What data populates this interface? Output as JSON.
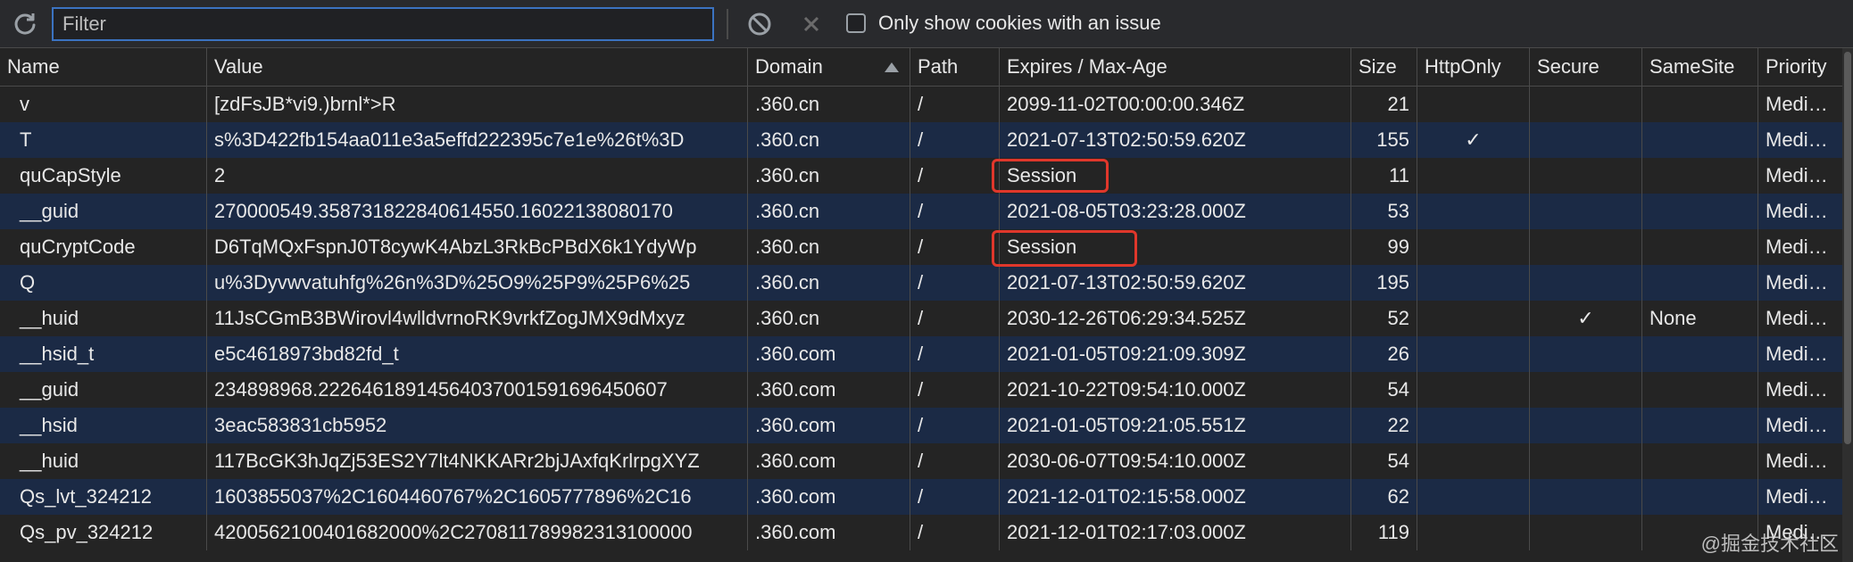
{
  "toolbar": {
    "filter_placeholder": "Filter",
    "only_issue_label": "Only show cookies with an issue"
  },
  "columns": {
    "name": "Name",
    "value": "Value",
    "domain": "Domain",
    "path": "Path",
    "expires": "Expires / Max-Age",
    "size": "Size",
    "httponly": "HttpOnly",
    "secure": "Secure",
    "samesite": "SameSite",
    "priority": "Priority"
  },
  "rows": [
    {
      "name": "v",
      "value": "[zdFsJB*vi9.)brnl*>R",
      "domain": ".360.cn",
      "path": "/",
      "expires": "2099-11-02T00:00:00.346Z",
      "size": "21",
      "httponly": "",
      "secure": "",
      "samesite": "",
      "priority": "Medium"
    },
    {
      "name": "T",
      "value": "s%3D422fb154aa011e3a5effd222395c7e1e%26t%3D",
      "domain": ".360.cn",
      "path": "/",
      "expires": "2021-07-13T02:50:59.620Z",
      "size": "155",
      "httponly": "✓",
      "secure": "",
      "samesite": "",
      "priority": "Medium"
    },
    {
      "name": "quCapStyle",
      "value": "2",
      "domain": ".360.cn",
      "path": "/",
      "expires": "Session",
      "size": "11",
      "httponly": "",
      "secure": "",
      "samesite": "",
      "priority": "Medium"
    },
    {
      "name": "__guid",
      "value": "270000549.358731822840614550.16022138080170",
      "domain": ".360.cn",
      "path": "/",
      "expires": "2021-08-05T03:23:28.000Z",
      "size": "53",
      "httponly": "",
      "secure": "",
      "samesite": "",
      "priority": "Medium"
    },
    {
      "name": "quCryptCode",
      "value": "D6TqMQxFspnJ0T8cywK4AbzL3RkBcPBdX6k1YdyWp",
      "domain": ".360.cn",
      "path": "/",
      "expires": "Session",
      "size": "99",
      "httponly": "",
      "secure": "",
      "samesite": "",
      "priority": "Medium"
    },
    {
      "name": "Q",
      "value": "u%3Dyvwvatuhfg%26n%3D%25O9%25P9%25P6%25",
      "domain": ".360.cn",
      "path": "/",
      "expires": "2021-07-13T02:50:59.620Z",
      "size": "195",
      "httponly": "",
      "secure": "",
      "samesite": "",
      "priority": "Medium"
    },
    {
      "name": "__huid",
      "value": "11JsCGmB3BWirovl4wlldvrnoRK9vrkfZogJMX9dMxyz",
      "domain": ".360.cn",
      "path": "/",
      "expires": "2030-12-26T06:29:34.525Z",
      "size": "52",
      "httponly": "",
      "secure": "✓",
      "samesite": "None",
      "priority": "Medium"
    },
    {
      "name": "__hsid_t",
      "value": "e5c4618973bd82fd_t",
      "domain": ".360.com",
      "path": "/",
      "expires": "2021-01-05T09:21:09.309Z",
      "size": "26",
      "httponly": "",
      "secure": "",
      "samesite": "",
      "priority": "Medium"
    },
    {
      "name": "__guid",
      "value": "234898968.22264618914564037001591696450607",
      "domain": ".360.com",
      "path": "/",
      "expires": "2021-10-22T09:54:10.000Z",
      "size": "54",
      "httponly": "",
      "secure": "",
      "samesite": "",
      "priority": "Medium"
    },
    {
      "name": "__hsid",
      "value": "3eac583831cb5952",
      "domain": ".360.com",
      "path": "/",
      "expires": "2021-01-05T09:21:05.551Z",
      "size": "22",
      "httponly": "",
      "secure": "",
      "samesite": "",
      "priority": "Medium"
    },
    {
      "name": "__huid",
      "value": "117BcGK3hJqZj53ES2Y7lt4NKKARr2bjJAxfqKrlrpgXYZ",
      "domain": ".360.com",
      "path": "/",
      "expires": "2030-06-07T09:54:10.000Z",
      "size": "54",
      "httponly": "",
      "secure": "",
      "samesite": "",
      "priority": "Medium"
    },
    {
      "name": "Qs_lvt_324212",
      "value": "1603855037%2C1604460767%2C1605777896%2C16",
      "domain": ".360.com",
      "path": "/",
      "expires": "2021-12-01T02:15:58.000Z",
      "size": "62",
      "httponly": "",
      "secure": "",
      "samesite": "",
      "priority": "Medium"
    },
    {
      "name": "Qs_pv_324212",
      "value": "4200562100401682000%2C270811789982313100000",
      "domain": ".360.com",
      "path": "/",
      "expires": "2021-12-01T02:17:03.000Z",
      "size": "119",
      "httponly": "",
      "secure": "",
      "samesite": "",
      "priority": "Medium"
    }
  ],
  "watermark": "@掘金技术社区"
}
